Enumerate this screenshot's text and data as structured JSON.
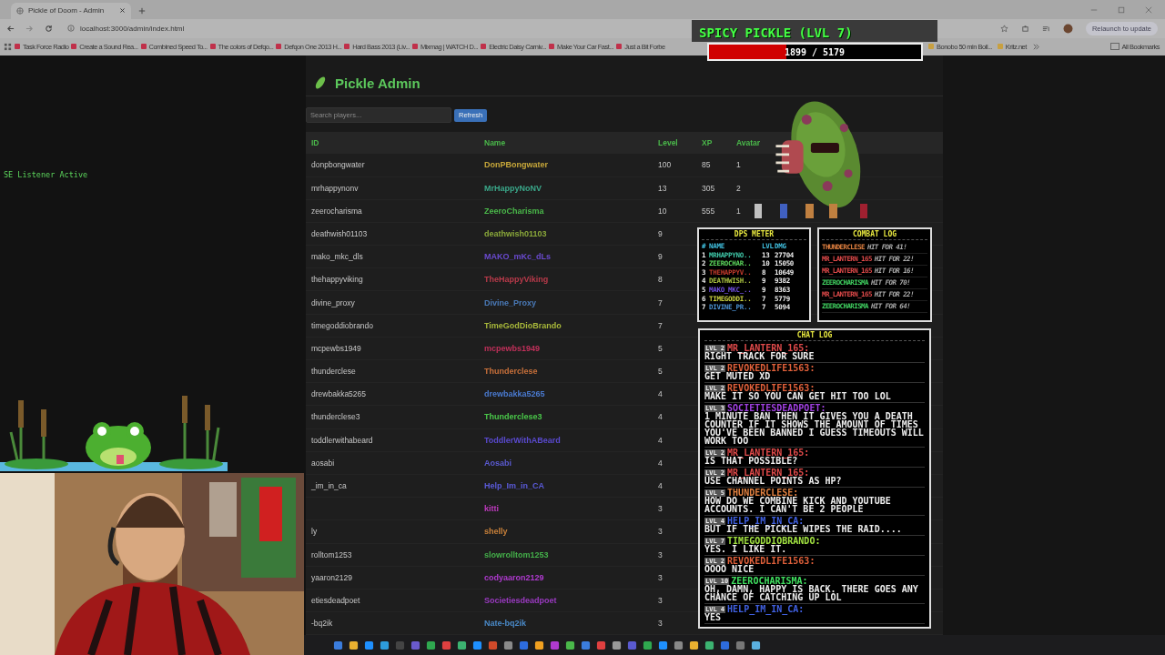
{
  "browser": {
    "tab_title": "Pickle of Doom - Admin",
    "url": "localhost:3000/admin/index.html",
    "bookmarks": [
      "Task Force Radio",
      "Create a Sound Rea...",
      "Combined Speed To...",
      "The colors of Defqo...",
      "Defqon One 2013 H...",
      "Hard Bass 2013 (Liv...",
      "Mixmag | WATCH D...",
      "Electric Daisy Carniv...",
      "Make Your Car Fast...",
      "Just a Bit Forbe"
    ],
    "bookmarks_right": [
      "Bonobo 50 min Boil...",
      "Kritz.net"
    ],
    "all_bookmarks": "All Bookmarks",
    "update_button": "Relaunch to update"
  },
  "listener_status": "SE Listener Active",
  "admin": {
    "title": "Pickle Admin",
    "search": {
      "placeholder": "Search players..."
    },
    "refresh": "Refresh",
    "columns": [
      "ID",
      "Name",
      "Level",
      "XP",
      "Avatar"
    ],
    "rows": [
      {
        "id": "donpbongwater",
        "name": "DonPBongwater",
        "color": "#c8a83a",
        "level": "100",
        "xp": "85",
        "avatar": "1"
      },
      {
        "id": "mrhappynonv",
        "name": "MrHappyNoNV",
        "color": "#3aa88a",
        "level": "13",
        "xp": "305",
        "avatar": "2"
      },
      {
        "id": "zeerocharisma",
        "name": "ZeeroCharisma",
        "color": "#4ab84a",
        "level": "10",
        "xp": "555",
        "avatar": "1"
      },
      {
        "id": "deathwish01103",
        "name": "deathwish01103",
        "color": "#8aa83a",
        "level": "9"
      },
      {
        "id": "mako_mkc_dls",
        "name": "MAKO_mKc_dLs",
        "color": "#6a4ad0",
        "level": "9"
      },
      {
        "id": "thehappyviking",
        "name": "TheHappyViking",
        "color": "#b83a4a",
        "level": "8"
      },
      {
        "id": "divine_proxy",
        "name": "Divine_Proxy",
        "color": "#4a7ab8",
        "level": "7"
      },
      {
        "id": "timegoddiobrando",
        "name": "TimeGodDioBrando",
        "color": "#a8b83a",
        "level": "7"
      },
      {
        "id": "mcpewbs1949",
        "name": "mcpewbs1949",
        "color": "#c0305a",
        "level": "5"
      },
      {
        "id": "thunderclese",
        "name": "Thunderclese",
        "color": "#c8703a",
        "level": "5"
      },
      {
        "id": "drewbakka5265",
        "name": "drewbakka5265",
        "color": "#4a7ad0",
        "level": "4"
      },
      {
        "id": "thunderclese3",
        "name": "Thunderclese3",
        "color": "#4ac84a",
        "level": "4"
      },
      {
        "id": "toddlerwithabeard",
        "name": "ToddlerWithABeard",
        "color": "#5a4ad0",
        "level": "4"
      },
      {
        "id": "aosabi",
        "name": "Aosabi",
        "color": "#5a5ad0",
        "level": "4"
      },
      {
        "id": "_im_in_ca",
        "name": "Help_Im_in_CA",
        "color": "#5a5ad8",
        "level": "4"
      },
      {
        "name": "kitti",
        "color": "#c03ac0",
        "level": "3"
      },
      {
        "id": "ly",
        "name": "shelly",
        "color": "#c8803a",
        "level": "3"
      },
      {
        "id": "rolltom1253",
        "name": "slowrolltom1253",
        "color": "#44b04a",
        "level": "3"
      },
      {
        "id": "yaaron2129",
        "name": "codyaaron2129",
        "color": "#b03ad0",
        "level": "3"
      },
      {
        "id": "etiesdeadpoet",
        "name": "Societiesdeadpoet",
        "color": "#9a3ac0",
        "level": "3"
      },
      {
        "id": "-bq2ik",
        "name": "Nate-bq2ik",
        "color": "#4a8ac8",
        "level": "3"
      }
    ]
  },
  "boss": {
    "title": "SPICY PICKLE (LVL 7)",
    "hp": "1899 / 5179",
    "level": 0.367
  },
  "dps_meter": {
    "title": "DPS METER",
    "columns": [
      "#",
      "NAME",
      "LVL",
      "DMG"
    ],
    "rows": [
      {
        "rank": "1",
        "name": "MRHAPPYNO..",
        "color": "#3fc7a8",
        "lvl": "13",
        "dmg": "27704"
      },
      {
        "rank": "2",
        "name": "ZEEROCHAR..",
        "color": "#5cd65c",
        "lvl": "10",
        "dmg": "15050"
      },
      {
        "rank": "3",
        "name": "THEHAPPYV..",
        "color": "#c0392b",
        "lvl": "8",
        "dmg": "10649"
      },
      {
        "rank": "4",
        "name": "DEATHWISH..",
        "color": "#a8c040",
        "lvl": "9",
        "dmg": "9382"
      },
      {
        "rank": "5",
        "name": "MAKO_MKC_..",
        "color": "#7050e0",
        "lvl": "9",
        "dmg": "8363"
      },
      {
        "rank": "6",
        "name": "TIMEGODDI..",
        "color": "#c8d040",
        "lvl": "7",
        "dmg": "5779"
      },
      {
        "rank": "7",
        "name": "DIVINE_PR..",
        "color": "#4a90d0",
        "lvl": "7",
        "dmg": "5094"
      }
    ]
  },
  "combat_log": {
    "title": "COMBAT LOG",
    "entries": [
      {
        "name": "THUNDERCLESE",
        "color": "#e08040",
        "text": "HIT FOR 41!"
      },
      {
        "name": "MR_LANTERN_165",
        "color": "#e04a4a",
        "text": "HIT FOR 22!"
      },
      {
        "name": "MR_LANTERN_165",
        "color": "#e04a4a",
        "text": "HIT FOR 16!"
      },
      {
        "name": "ZEEROCHARISMA",
        "color": "#40d060",
        "text": "HIT FOR 70!"
      },
      {
        "name": "MR_LANTERN_165",
        "color": "#e04a4a",
        "text": "HIT FOR 22!"
      },
      {
        "name": "ZEEROCHARISMA",
        "color": "#40d060",
        "text": "HIT FOR 64!"
      }
    ]
  },
  "chat_log": {
    "title": "CHAT LOG",
    "messages": [
      {
        "badge": "LVL 2",
        "name": "MR_LANTERN_165:",
        "color": "#e04a4a",
        "text": "RIGHT TRACK FOR SURE"
      },
      {
        "badge": "LVL 2",
        "name": "REVOKEDLIFE1563:",
        "color": "#e0603a",
        "text": "GET MUTED XD"
      },
      {
        "badge": "LVL 2",
        "name": "REVOKEDLIFE1563:",
        "color": "#e0603a",
        "text": "MAKE IT SO YOU CAN GET HIT TOO LOL"
      },
      {
        "badge": "LVL 3",
        "name": "SOCIETIESDEADPOET:",
        "color": "#a040e0",
        "text": "1 MINUTE BAN THEN IT GIVES YOU A DEATH COUNTER IF IT SHOWS THE AMOUNT OF TIMES YOU'VE BEEN BANNED I GUESS TIMEOUTS WILL WORK TOO"
      },
      {
        "badge": "LVL 2",
        "name": "MR_LANTERN_165:",
        "color": "#e04a4a",
        "text": "IS THAT POSSIBLE?"
      },
      {
        "badge": "LVL 2",
        "name": "MR_LANTERN_165:",
        "color": "#e04a4a",
        "text": "USE CHANNEL POINTS AS HP?"
      },
      {
        "badge": "LVL 5",
        "name": "THUNDERCLESE:",
        "color": "#e08040",
        "text": "HOW DO WE COMBINE KICK AND YOUTUBE ACCOUNTS. I CAN'T BE 2 PEOPLE"
      },
      {
        "badge": "LVL 4",
        "name": "HELP_IM_IN_CA:",
        "color": "#4060e0",
        "text": "BUT IF THE PICKLE WIPES THE RAID...."
      },
      {
        "badge": "LVL 7",
        "name": "TIMEGODDIOBRANDO:",
        "color": "#a0e040",
        "text": "YES. I LIKE IT."
      },
      {
        "badge": "LVL 2",
        "name": "REVOKEDLIFE1563:",
        "color": "#e0603a",
        "text": "OOOO NICE"
      },
      {
        "badge": "LVL 10",
        "name": "ZEEROCHARISMA:",
        "color": "#40e060",
        "text": "OH, DAMN, HAPPY IS BACK. THERE GOES ANY CHANCE OF CATCHING UP LOL"
      },
      {
        "badge": "LVL 4",
        "name": "HELP_IM_IN_CA:",
        "color": "#4060e0",
        "text": "YES"
      }
    ]
  }
}
